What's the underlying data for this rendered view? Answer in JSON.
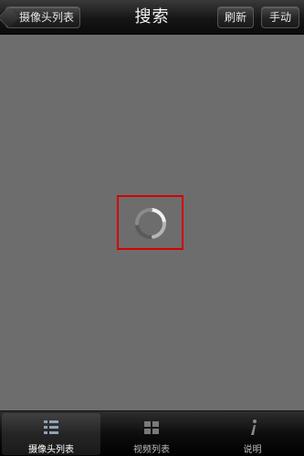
{
  "navbar": {
    "back_label": "摄像头列表",
    "title": "搜索",
    "refresh_label": "刷新",
    "manual_label": "手动"
  },
  "tabbar": {
    "tabs": [
      {
        "label": "摄像头列表",
        "icon": "camera-list-icon",
        "active": true
      },
      {
        "label": "视频列表",
        "icon": "video-list-icon",
        "active": false
      },
      {
        "label": "说明",
        "icon": "info-icon",
        "active": false
      }
    ]
  },
  "colors": {
    "navbar": "#161616",
    "content_background": "#6d6d6d",
    "highlight_frame": "#d40000",
    "tabbar": "#0d0d0d"
  }
}
